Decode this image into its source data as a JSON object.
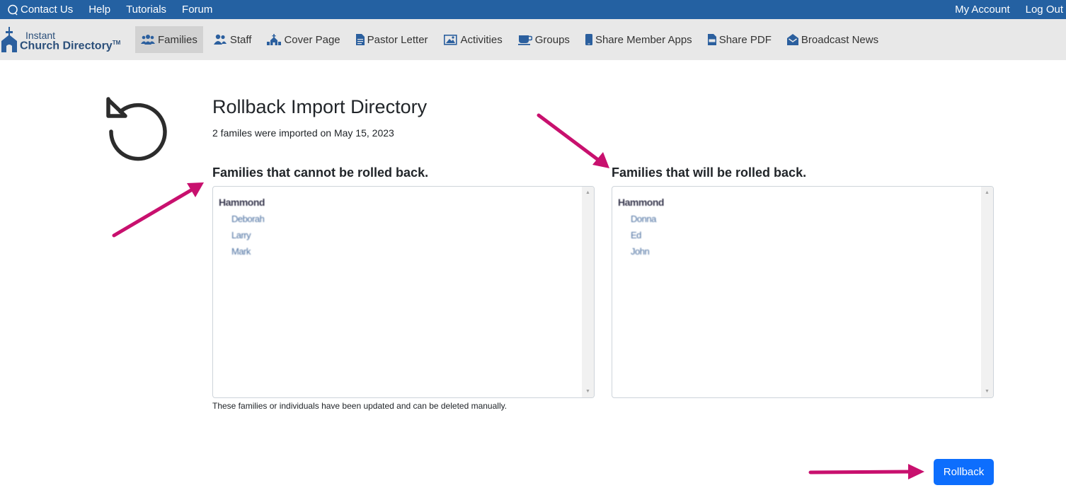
{
  "topbar": {
    "left": [
      {
        "label": "Contact Us",
        "icon": "chat-bubble-icon"
      },
      {
        "label": "Help"
      },
      {
        "label": "Tutorials"
      },
      {
        "label": "Forum"
      }
    ],
    "right": [
      {
        "label": "My Account"
      },
      {
        "label": "Log Out"
      }
    ]
  },
  "logo": {
    "line1": "Instant",
    "line2": "Church Directory",
    "tm": "TM"
  },
  "nav": {
    "items": [
      {
        "label": "Families",
        "icon": "families-icon",
        "active": true
      },
      {
        "label": "Staff",
        "icon": "staff-icon"
      },
      {
        "label": "Cover Page",
        "icon": "church-icon"
      },
      {
        "label": "Pastor Letter",
        "icon": "document-icon"
      },
      {
        "label": "Activities",
        "icon": "photos-icon"
      },
      {
        "label": "Groups",
        "icon": "coffee-cup-icon"
      },
      {
        "label": "Share Member Apps",
        "icon": "mobile-icon"
      },
      {
        "label": "Share PDF",
        "icon": "pdf-file-icon"
      },
      {
        "label": "Broadcast News",
        "icon": "envelope-open-icon"
      }
    ]
  },
  "page": {
    "title": "Rollback Import Directory",
    "subtitle": "2 familes were imported on May 15, 2023",
    "cannot_heading": "Families that cannot be rolled back.",
    "will_heading": "Families that will be rolled back.",
    "cannot_family": "Hammond",
    "cannot_members": [
      "Deborah",
      "Larry",
      "Mark"
    ],
    "will_family": "Hammond",
    "will_members": [
      "Donna",
      "Ed",
      "John"
    ],
    "note": "These families or individuals have been updated and can be deleted manually.",
    "rollback_button": "Rollback"
  },
  "colors": {
    "topbar": "#2461a2",
    "navbar": "#e8e8e8",
    "button": "#0d6efd",
    "annotation_arrow": "#c8106e"
  }
}
